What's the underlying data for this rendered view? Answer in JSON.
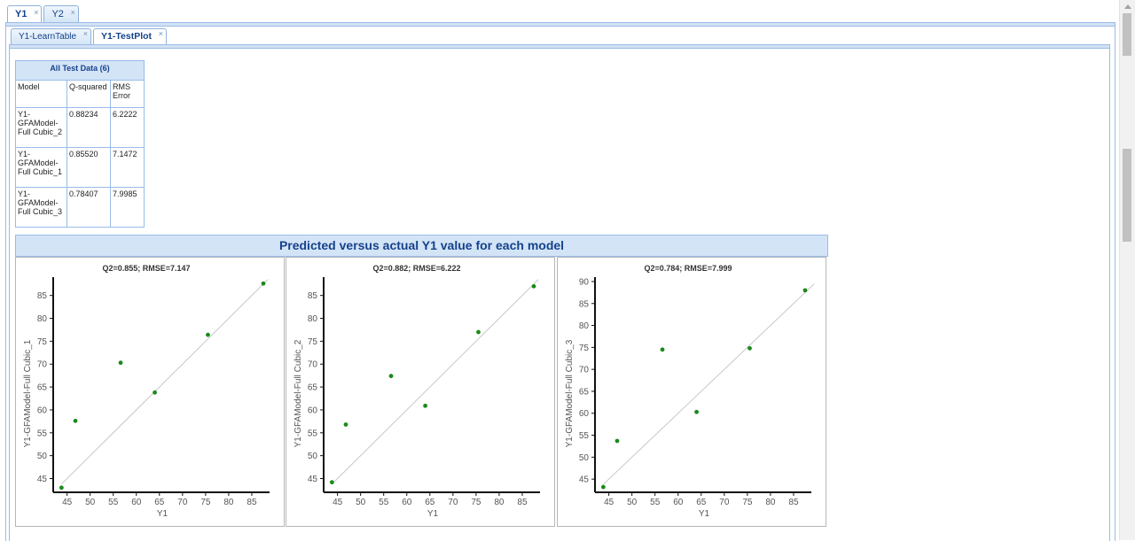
{
  "tabs": [
    {
      "label": "Y1"
    },
    {
      "label": "Y2"
    }
  ],
  "subtabs": [
    {
      "label": "Y1-LearnTable"
    },
    {
      "label": "Y1-TestPlot"
    }
  ],
  "close_glyph": "×",
  "table": {
    "title": "All Test Data (6)",
    "headers": [
      "Model",
      "Q-squared",
      "RMS Error"
    ],
    "rows": [
      {
        "model": "Y1-GFAModel-Full Cubic_2",
        "q2": "0.88234",
        "rms": "6.2222"
      },
      {
        "model": "Y1-GFAModel-Full Cubic_1",
        "q2": "0.85520",
        "rms": "7.1472"
      },
      {
        "model": "Y1-GFAModel-Full Cubic_3",
        "q2": "0.78407",
        "rms": "7.9985"
      }
    ]
  },
  "chart_header": "Predicted versus actual Y1 value for each model",
  "chart_data": [
    {
      "type": "scatter",
      "title": "Q2=0.855; RMSE=7.147",
      "xlabel": "Y1",
      "ylabel": "Y1-GFAModel-Full Cubic_1",
      "xlim": [
        42,
        90
      ],
      "ylim": [
        42,
        89
      ],
      "xticks": [
        45,
        50,
        55,
        60,
        65,
        70,
        75,
        80,
        85
      ],
      "yticks": [
        45,
        50,
        55,
        60,
        65,
        70,
        75,
        80,
        85
      ],
      "points": [
        [
          43.8,
          43.0
        ],
        [
          46.8,
          57.6
        ],
        [
          56.6,
          70.3
        ],
        [
          64.0,
          63.8
        ],
        [
          75.5,
          76.4
        ],
        [
          87.5,
          87.6
        ]
      ],
      "point_color": "#1a8a1a"
    },
    {
      "type": "scatter",
      "title": "Q2=0.882; RMSE=6.222",
      "xlabel": "Y1",
      "ylabel": "Y1-GFAModel-Full Cubic_2",
      "xlim": [
        42,
        90
      ],
      "ylim": [
        42,
        89
      ],
      "xticks": [
        45,
        50,
        55,
        60,
        65,
        70,
        75,
        80,
        85
      ],
      "yticks": [
        45,
        50,
        55,
        60,
        65,
        70,
        75,
        80,
        85
      ],
      "points": [
        [
          43.8,
          44.2
        ],
        [
          46.8,
          56.8
        ],
        [
          56.6,
          67.4
        ],
        [
          64.0,
          60.9
        ],
        [
          75.5,
          77.0
        ],
        [
          87.5,
          87.0
        ]
      ],
      "point_color": "#1a8a1a"
    },
    {
      "type": "scatter",
      "title": "Q2=0.784; RMSE=7.999",
      "xlabel": "Y1",
      "ylabel": "Y1-GFAModel-Full Cubic_3",
      "xlim": [
        42,
        90
      ],
      "ylim": [
        42,
        91
      ],
      "xticks": [
        45,
        50,
        55,
        60,
        65,
        70,
        75,
        80,
        85
      ],
      "yticks": [
        45,
        50,
        55,
        60,
        65,
        70,
        75,
        80,
        85,
        90
      ],
      "points": [
        [
          43.8,
          43.2
        ],
        [
          46.8,
          53.7
        ],
        [
          56.6,
          74.5
        ],
        [
          64.0,
          60.3
        ],
        [
          75.5,
          74.8
        ],
        [
          87.5,
          88.0
        ]
      ],
      "point_color": "#1a8a1a"
    }
  ]
}
